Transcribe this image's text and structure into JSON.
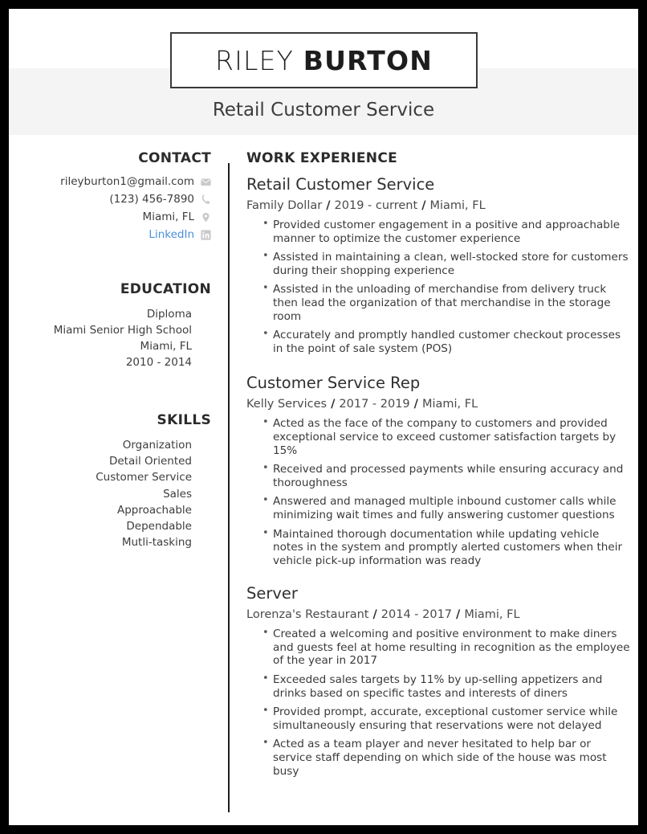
{
  "header": {
    "first_name": "RILEY",
    "last_name": "BURTON",
    "headline": "Retail Customer Service"
  },
  "sidebar": {
    "contact": {
      "heading": "CONTACT",
      "items": [
        {
          "text": "rileyburton1@gmail.com",
          "icon": "envelope-icon",
          "link": false
        },
        {
          "text": "(123) 456-7890",
          "icon": "phone-icon",
          "link": false
        },
        {
          "text": "Miami, FL",
          "icon": "location-pin-icon",
          "link": false
        },
        {
          "text": "LinkedIn",
          "icon": "linkedin-icon",
          "link": true
        }
      ]
    },
    "education": {
      "heading": "EDUCATION",
      "lines": [
        "Diploma",
        "Miami Senior High School",
        "Miami, FL",
        "2010 - 2014"
      ]
    },
    "skills": {
      "heading": "SKILLS",
      "items": [
        "Organization",
        "Detail Oriented",
        "Customer Service",
        "Sales",
        "Approachable",
        "Dependable",
        "Mutli-tasking"
      ]
    }
  },
  "main": {
    "heading": "WORK EXPERIENCE",
    "jobs": [
      {
        "title": "Retail Customer Service",
        "company": "Family Dollar",
        "dates": "2019 - current",
        "location": "Miami, FL",
        "bullets": [
          "Provided customer engagement in a positive and approachable manner to optimize the customer experience",
          "Assisted in maintaining a clean, well-stocked store for customers during their shopping experience",
          "Assisted in the unloading of merchandise from delivery truck then lead the organization of that merchandise in the storage room",
          "Accurately and promptly handled customer checkout processes in the point of sale system (POS)"
        ]
      },
      {
        "title": "Customer Service Rep",
        "company": "Kelly Services",
        "dates": "2017 - 2019",
        "location": "Miami, FL",
        "bullets": [
          "Acted as the face of the company to customers and provided exceptional service to exceed customer satisfaction targets by 15%",
          "Received and processed payments while ensuring accuracy and thoroughness",
          "Answered and managed multiple inbound customer calls while minimizing wait times and fully answering customer questions",
          "Maintained thorough documentation while updating vehicle notes in the system and promptly alerted customers when their vehicle pick-up information was ready"
        ]
      },
      {
        "title": "Server",
        "company": "Lorenza's Restaurant",
        "dates": "2014 - 2017",
        "location": "Miami, FL",
        "bullets": [
          "Created a welcoming and positive environment to make diners and guests feel at home resulting in recognition as the employee of the year in 2017",
          "Exceeded sales targets by 11% by up-selling appetizers and drinks based on specific tastes and interests of diners",
          "Provided prompt, accurate, exceptional customer service while simultaneously ensuring that reservations were not delayed",
          "Acted as a team player and never hesitated to help bar or service staff depending on which side of the house was most busy"
        ]
      }
    ]
  },
  "colors": {
    "page_border": "#000000",
    "band_background": "#f4f4f4",
    "heading_text": "#2b2b2b",
    "body_text": "#3a3a3a",
    "link_blue": "#4a90d9",
    "divider": "#1f1f1f",
    "icon_gray": "#c9c9c9"
  },
  "separator": "/"
}
